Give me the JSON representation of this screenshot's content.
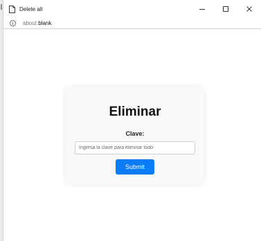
{
  "window": {
    "title": "Delete all",
    "controls": {
      "minimize_icon": "minimize-icon",
      "maximize_icon": "maximize-icon",
      "close_icon": "close-icon"
    }
  },
  "addressbar": {
    "url_prefix": "about:",
    "url_rest": "blank"
  },
  "form": {
    "title": "Eliminar",
    "label": "Clave:",
    "input_placeholder": "Ingresa la clave para eliminar todo",
    "input_value": "",
    "submit_label": "Submit"
  },
  "colors": {
    "button": "#0a7cf5",
    "card_bg": "#f9f9f9"
  }
}
